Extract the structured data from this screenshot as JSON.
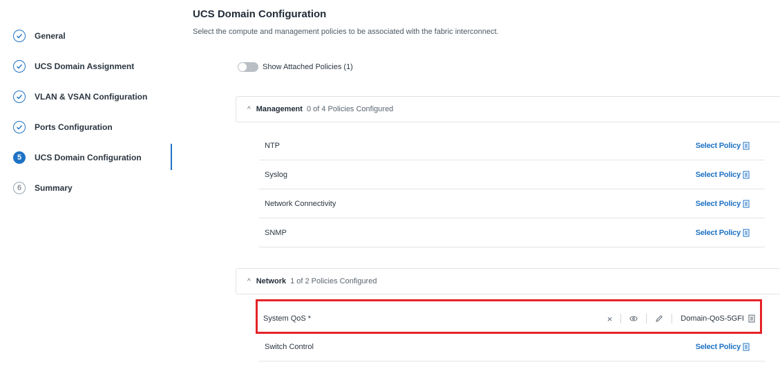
{
  "sidebar": {
    "steps": [
      {
        "label": "General",
        "marker": "check-icon"
      },
      {
        "label": "UCS Domain Assignment",
        "marker": "check-icon"
      },
      {
        "label": "VLAN & VSAN Configuration",
        "marker": "check-icon"
      },
      {
        "label": "Ports Configuration",
        "marker": "check-icon"
      },
      {
        "label": "UCS Domain Configuration",
        "marker": "5"
      },
      {
        "label": "Summary",
        "marker": "6"
      }
    ]
  },
  "main": {
    "title": "UCS Domain Configuration",
    "subtitle": "Select the compute and management policies to be associated with the fabric interconnect.",
    "toggle_label": "Show Attached Policies (1)"
  },
  "management": {
    "title": "Management",
    "count": "0 of 4 Policies Configured",
    "rows": [
      {
        "name": "NTP",
        "action": "Select Policy"
      },
      {
        "name": "Syslog",
        "action": "Select Policy"
      },
      {
        "name": "Network Connectivity",
        "action": "Select Policy"
      },
      {
        "name": "SNMP",
        "action": "Select Policy"
      }
    ]
  },
  "network": {
    "title": "Network",
    "count": "1 of 2 Policies Configured",
    "qos": {
      "name": "System QoS *",
      "clear": "×",
      "value": "Domain-QoS-5GFI"
    },
    "switch_control": {
      "name": "Switch Control",
      "action": "Select Policy"
    }
  },
  "colors": {
    "accent": "#1e72c4",
    "highlight": "#e32226"
  }
}
